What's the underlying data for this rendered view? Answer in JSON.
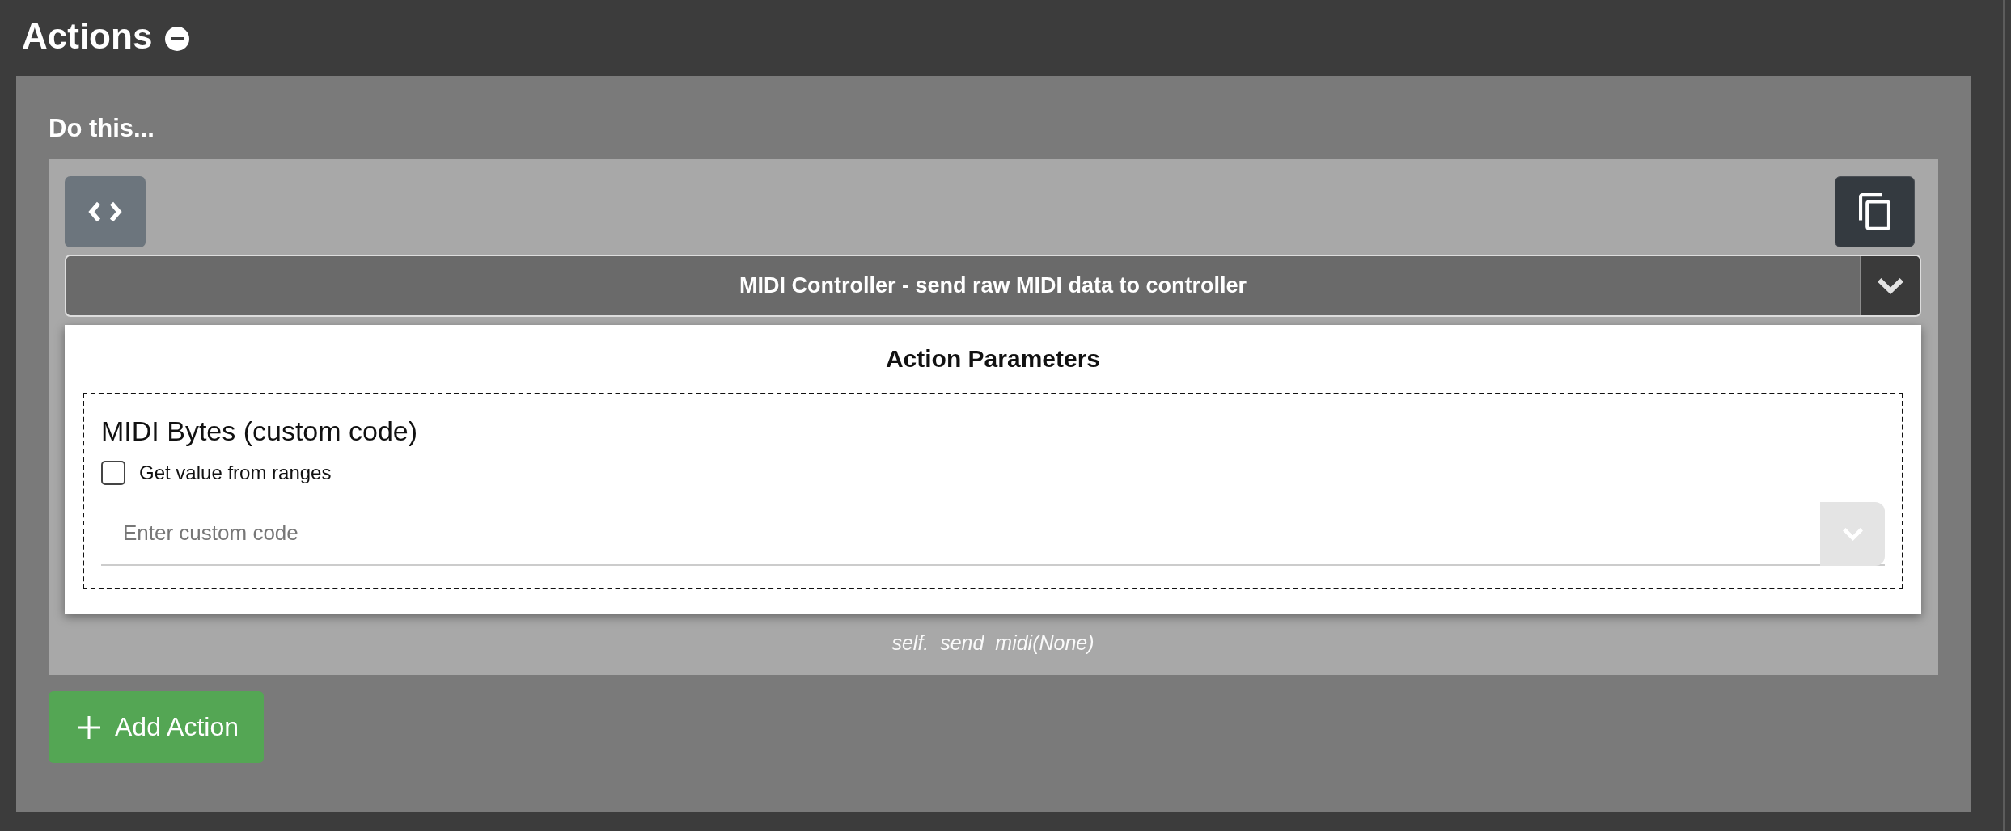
{
  "header": {
    "title": "Actions",
    "expanded": true
  },
  "panel": {
    "heading": "Do this..."
  },
  "actions": [
    {
      "action_select": {
        "value": "MIDI Controller - send raw MIDI data to controller"
      },
      "parameters": {
        "title": "Action Parameters",
        "fields": [
          {
            "label": "MIDI Bytes (custom code)",
            "checkbox": {
              "label": "Get value from ranges",
              "checked": false
            },
            "input": {
              "placeholder": "Enter custom code"
            }
          }
        ]
      },
      "code_preview": "self._send_midi(None)"
    }
  ],
  "add_button": {
    "label": "Add Action"
  }
}
